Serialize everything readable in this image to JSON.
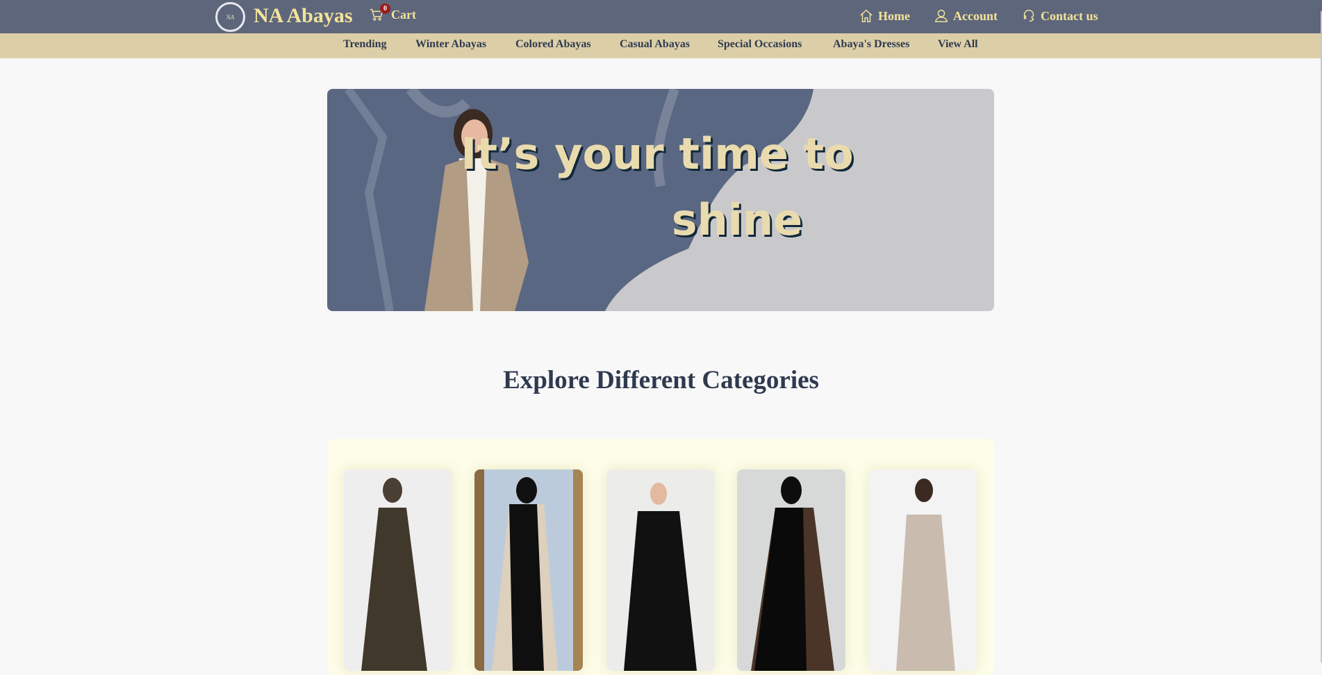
{
  "header": {
    "logo_text": "NA",
    "brand": "NA Abayas",
    "cart": {
      "label": "Cart",
      "count": "0",
      "icon": "cart-icon"
    },
    "nav": [
      {
        "label": "Home",
        "icon": "home-icon"
      },
      {
        "label": "Account",
        "icon": "user-icon"
      },
      {
        "label": "Contact us",
        "icon": "headset-icon"
      }
    ]
  },
  "categories_nav": [
    "Trending",
    "Winter Abayas",
    "Colored Abayas",
    "Casual Abayas",
    "Special Occasions",
    "Abaya's Dresses",
    "View All"
  ],
  "banner": {
    "line1": "It’s your time to",
    "line2": "shine"
  },
  "section": {
    "title": "Explore Different Categories"
  },
  "colors": {
    "header_bg": "#5d667b",
    "accent_text": "#f3e39a",
    "subnav_bg": "#dccfa8",
    "subnav_text": "#2f3a4f",
    "badge": "#9b1c1c",
    "panel_bg": "#fdfde9"
  }
}
